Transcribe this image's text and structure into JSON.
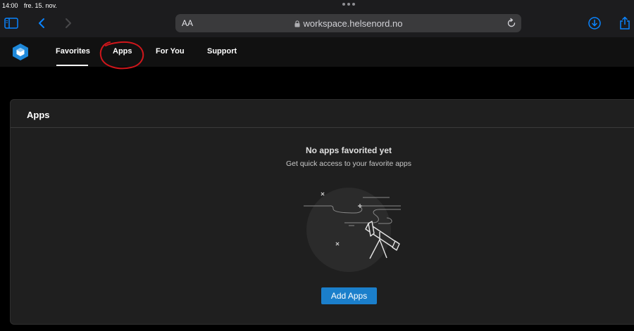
{
  "status_bar": {
    "time": "14:00",
    "date": "fre. 15. nov."
  },
  "browser": {
    "text_size_label": "AA",
    "url": "workspace.helsenord.no"
  },
  "nav": {
    "tabs": [
      "Favorites",
      "Apps",
      "For You",
      "Support"
    ],
    "active_tab": "Favorites"
  },
  "card": {
    "title": "Apps",
    "empty_title": "No apps favorited yet",
    "empty_subtitle": "Get quick access to your favorite apps",
    "add_button": "Add Apps"
  },
  "colors": {
    "accent": "#1b7fcb",
    "annotation": "#d0161b",
    "logo": "#1e88d9"
  }
}
